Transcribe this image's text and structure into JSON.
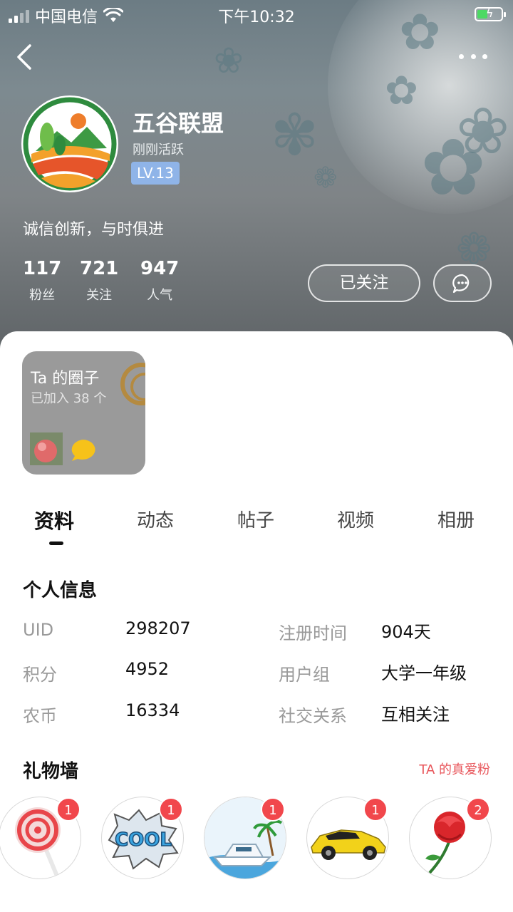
{
  "status_bar": {
    "carrier": "中国电信",
    "time": "下午10:32"
  },
  "profile": {
    "name": "五谷联盟",
    "activity": "刚刚活跃",
    "level": "LV.13",
    "motto": "诚信创新，与时俱进",
    "stats": [
      {
        "value": "117",
        "label": "粉丝"
      },
      {
        "value": "721",
        "label": "关注"
      },
      {
        "value": "947",
        "label": "人气"
      }
    ],
    "follow_label": "已关注"
  },
  "circle_card": {
    "title": "Ta 的圈子",
    "subtitle": "已加入 38 个"
  },
  "tabs": [
    "资料",
    "动态",
    "帖子",
    "视频",
    "相册"
  ],
  "personal_info": {
    "title": "个人信息",
    "rows": [
      {
        "label": "UID",
        "value": "298207"
      },
      {
        "label": "积分",
        "value": "4952"
      },
      {
        "label": "农币",
        "value": "16334"
      },
      {
        "label": "注册时间",
        "value": "904天"
      },
      {
        "label": "用户组",
        "value": "大学一年级"
      },
      {
        "label": "社交关系",
        "value": "互相关注"
      }
    ]
  },
  "gift_wall": {
    "title": "礼物墙",
    "link": "TA 的真爱粉",
    "gifts": [
      {
        "name": "lollipop",
        "count": "1"
      },
      {
        "name": "cool",
        "count": "1"
      },
      {
        "name": "yacht",
        "count": "1"
      },
      {
        "name": "sports-car",
        "count": "1"
      },
      {
        "name": "rose",
        "count": "2"
      }
    ]
  }
}
